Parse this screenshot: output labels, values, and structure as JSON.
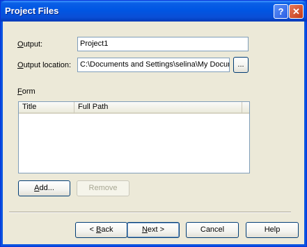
{
  "window": {
    "title": "Project Files"
  },
  "titlebar": {
    "help_glyph": "?",
    "close_glyph": "✕"
  },
  "form": {
    "output_label_key": "O",
    "output_label_rest": "utput:",
    "output_value": "Project1",
    "location_label_key": "O",
    "location_label_rest": "utput location:",
    "location_value": "C:\\Documents and Settings\\selina\\My Docum",
    "browse_label": "...",
    "form_label_key": "F",
    "form_label_rest": "orm"
  },
  "list": {
    "columns": [
      "Title",
      "Full Path"
    ]
  },
  "buttons": {
    "add_key": "A",
    "add_rest": "dd...",
    "remove": "Remove",
    "back_pre": "< ",
    "back_key": "B",
    "back_rest": "ack",
    "next_key": "N",
    "next_rest": "ext >",
    "cancel": "Cancel",
    "help": "Help"
  }
}
